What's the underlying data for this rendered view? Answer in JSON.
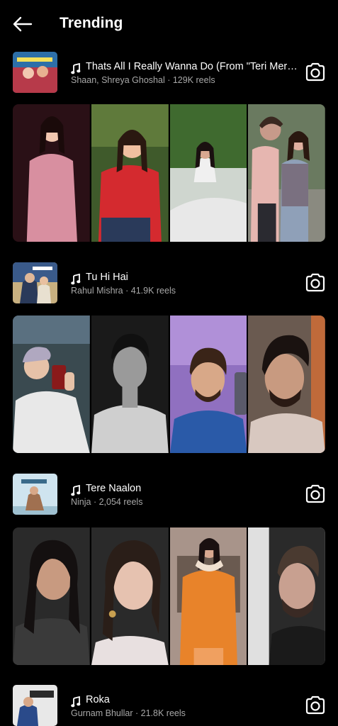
{
  "header": {
    "title": "Trending"
  },
  "tracks": [
    {
      "song": "Thats All I Really Wanna Do (From \"Teri Meri Kah...",
      "meta": "Shaan, Shreya Ghoshal · 129K reels",
      "cover_colors": [
        "#b73a4a",
        "#2d6fa8"
      ],
      "reel_colors": [
        [
          "#2a1016",
          "#d88fa0",
          "#f2c7b0"
        ],
        [
          "#3f5a2b",
          "#d42a2f",
          "#f0c0a0"
        ],
        [
          "#3f6a2f",
          "#e8e8e8",
          "#6a4a3a"
        ],
        [
          "#6a7a60",
          "#e6b6b0",
          "#c79a8a"
        ]
      ]
    },
    {
      "song": "Tu Hi Hai",
      "meta": "Rahul Mishra · 41.9K reels",
      "cover_colors": [
        "#3a5a8a",
        "#c8b080"
      ],
      "reel_colors": [
        [
          "#3a4a50",
          "#e8e8e8",
          "#e6c2a8"
        ],
        [
          "#1a1a1a",
          "#cfcfcf",
          "#9a9a9a"
        ],
        [
          "#9070c0",
          "#2a5aa8",
          "#d8a888"
        ],
        [
          "#6a5a50",
          "#d8c8c0",
          "#c89a80"
        ]
      ]
    },
    {
      "song": "Tere Naalon",
      "meta": "Ninja · 2,054 reels",
      "cover_colors": [
        "#cfe4ef",
        "#a07050"
      ],
      "reel_colors": [
        [
          "#2a2a2a",
          "#3a3a3a",
          "#c89a80"
        ],
        [
          "#2a2a2a",
          "#e8e0e0",
          "#e6c2b0"
        ],
        [
          "#a8948a",
          "#e8832a",
          "#d8a890"
        ],
        [
          "#2a2a2a",
          "#f0f0f0",
          "#c8a090"
        ]
      ]
    },
    {
      "song": "Roka",
      "meta": "Gurnam Bhullar · 21.8K reels",
      "cover_colors": [
        "#e8e8e8",
        "#2a4a8a"
      ],
      "reel_colors": []
    }
  ]
}
